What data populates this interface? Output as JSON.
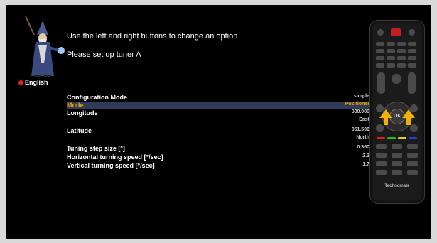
{
  "language": {
    "label": "English"
  },
  "instructions": {
    "line1": "Use the left and right buttons to change an option.",
    "line2": "Please set up tuner A"
  },
  "config": {
    "rows": [
      {
        "label": "Configuration Mode",
        "value": "simple"
      },
      {
        "label": "Mode",
        "value": "Positioner",
        "selected": true
      },
      {
        "label": "Longitude",
        "value": "000.000",
        "sub": "East"
      },
      {
        "label": "Latitude",
        "value": "051.500",
        "sub": "North"
      },
      {
        "label": "Tuning step size [°]",
        "value": "0.360"
      },
      {
        "label": "Horizontal turning speed [°/sec]",
        "value": "2.3"
      },
      {
        "label": "Vertical turning speed [°/sec]",
        "value": "1.7"
      }
    ]
  },
  "remote": {
    "brand": "Technomate",
    "ok_label": "OK",
    "colors": {
      "red": "#e02020",
      "green": "#20c020",
      "yellow": "#e0d020",
      "blue": "#2040e0",
      "arrow": "#f2b000"
    }
  }
}
